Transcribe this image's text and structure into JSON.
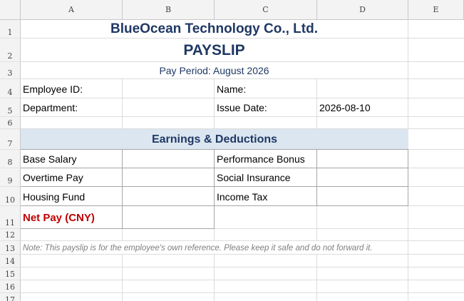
{
  "columns": [
    "A",
    "B",
    "C",
    "D",
    "E"
  ],
  "rows": [
    "1",
    "2",
    "3",
    "4",
    "5",
    "6",
    "7",
    "8",
    "9",
    "10",
    "11",
    "12",
    "13",
    "14",
    "15",
    "16",
    "17"
  ],
  "company": "BlueOcean Technology Co., Ltd.",
  "title": "PAYSLIP",
  "pay_period": "Pay Period: August 2026",
  "fields": {
    "employee_id_label": "Employee ID:",
    "name_label": "Name:",
    "department_label": "Department:",
    "issue_date_label": "Issue Date:",
    "issue_date_value": "2026-08-10"
  },
  "section_header": "Earnings & Deductions",
  "items": {
    "base_salary": "Base Salary",
    "performance_bonus": "Performance Bonus",
    "overtime_pay": "Overtime Pay",
    "social_insurance": "Social Insurance",
    "housing_fund": "Housing Fund",
    "income_tax": "Income Tax",
    "net_pay": "Net Pay (CNY)"
  },
  "note": "Note: This payslip is for the employee's own reference. Please keep it safe and do not forward it.",
  "colors": {
    "title": "#1f3864",
    "header_fill": "#dce6f1",
    "net_pay": "#c00000",
    "note": "#7f7f7f"
  }
}
